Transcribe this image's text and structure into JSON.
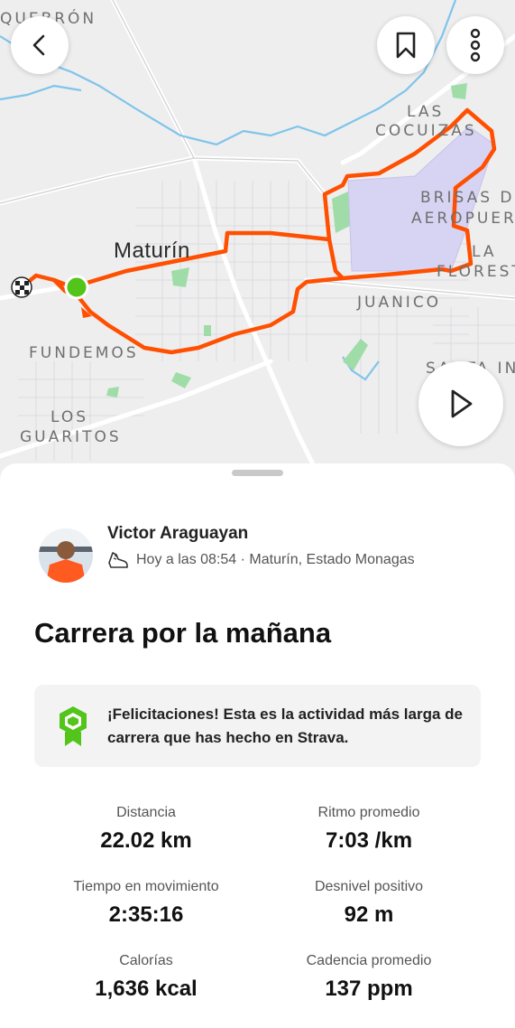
{
  "map": {
    "labels": {
      "quebron": "QUEBRÓN",
      "las": "LAS",
      "cocuizas": "COCUIZAS",
      "brisas_del": "BRISAS DI",
      "aeropuerto": "AEROPUER",
      "la": "LA",
      "floresta": "FLOREST",
      "maturin": "Maturín",
      "juanico": "JUANICO",
      "fundemos": "FUNDEMOS",
      "los": "LOS",
      "guaritos": "GUARITOS",
      "santa_ines": "SANTA IN"
    },
    "colors": {
      "route": "#ff4f00",
      "start": "#52c41a",
      "water": "#7fc4ea",
      "park": "#9fdca8",
      "airport": "#d7d3f3"
    }
  },
  "buttons": {
    "back_icon": "chevron-left-icon",
    "bookmark_icon": "bookmark-icon",
    "more_icon": "more-vertical-icon",
    "play_icon": "play-icon"
  },
  "athlete": {
    "name": "Victor Araguayan",
    "meta": "Hoy a las 08:54 · Maturín, Estado Monagas"
  },
  "activity": {
    "title": "Carrera por la mañana",
    "achievement": "¡Felicitaciones! Esta es la actividad más larga de carrera que has hecho en Strava."
  },
  "stats": [
    {
      "label": "Distancia",
      "value": "22.02 km"
    },
    {
      "label": "Ritmo promedio",
      "value": "7:03 /km"
    },
    {
      "label": "Tiempo en movimiento",
      "value": "2:35:16"
    },
    {
      "label": "Desnivel positivo",
      "value": "92 m"
    },
    {
      "label": "Calorías",
      "value": "1,636 kcal"
    },
    {
      "label": "Cadencia promedio",
      "value": "137 ppm"
    }
  ]
}
